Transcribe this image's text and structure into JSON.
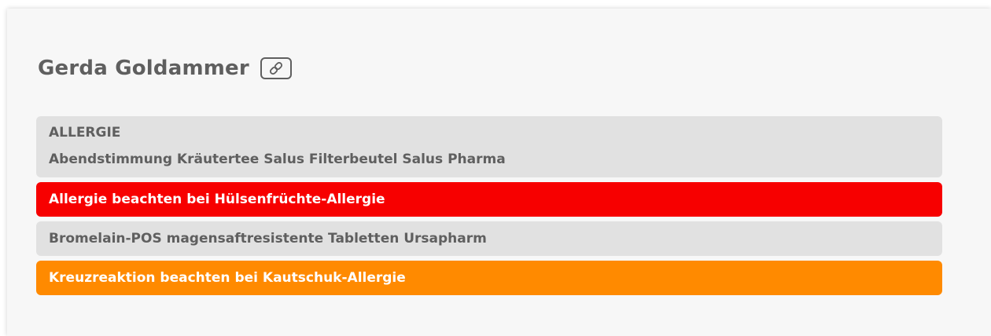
{
  "patient": {
    "name": "Gerda Goldammer",
    "link_icon": "link-icon"
  },
  "allergy_section": {
    "heading": "ALLERGIE",
    "entries": [
      {
        "text": "Abendstimmung Kräutertee Salus Filterbeutel Salus Pharma",
        "style": "grey"
      },
      {
        "text": "Allergie beachten bei Hülsenfrüchte-Allergie",
        "style": "red"
      },
      {
        "text": "Bromelain-POS magensaftresistente Tabletten Ursapharm",
        "style": "grey"
      },
      {
        "text": "Kreuzreaktion beachten bei Kautschuk-Allergie",
        "style": "orange"
      }
    ]
  },
  "colors": {
    "warning_red": "#f70000",
    "warning_orange": "#ff8a00",
    "neutral_row": "#e1e1e1",
    "text_grey": "#5f5f5f"
  }
}
